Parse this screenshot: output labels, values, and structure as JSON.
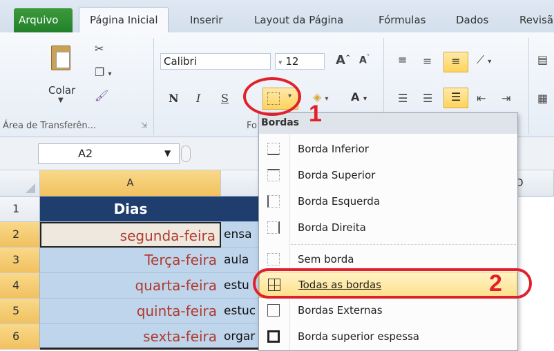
{
  "tabs": {
    "arquivo": "Arquivo",
    "inicio": "Página Inicial",
    "inserir": "Inserir",
    "layout": "Layout da Página",
    "formulas": "Fórmulas",
    "dados": "Dados",
    "revisao": "Revisã"
  },
  "ribbon": {
    "paste_label": "Colar",
    "clipboard_group": "Área de Transferên...",
    "font_group_partial": "Fo",
    "font_name": "Calibri",
    "font_size": "12",
    "bold": "N",
    "italic": "I",
    "underline": "S"
  },
  "name_box": "A2",
  "columns": [
    "A"
  ],
  "col_d_partial": "D",
  "rows": [
    {
      "num": "1",
      "a": "Dias",
      "b": ""
    },
    {
      "num": "2",
      "a": "segunda-feira",
      "b": "ensa"
    },
    {
      "num": "3",
      "a": "Terça-feira",
      "b": "aula"
    },
    {
      "num": "4",
      "a": "quarta-feira",
      "b": "estu"
    },
    {
      "num": "5",
      "a": "quinta-feira",
      "b": "estuc"
    },
    {
      "num": "6",
      "a": "sexta-feira",
      "b": "orgar"
    }
  ],
  "menu": {
    "title": "Bordas",
    "items": [
      {
        "label": "Borda Inferior",
        "icon": "border-bottom-icon"
      },
      {
        "label": "Borda Superior",
        "icon": "border-top-icon"
      },
      {
        "label": "Borda Esquerda",
        "icon": "border-left-icon"
      },
      {
        "label": "Borda Direita",
        "icon": "border-right-icon"
      },
      {
        "label": "Sem borda",
        "icon": "no-border-icon"
      },
      {
        "label": "Todas as bordas",
        "icon": "all-borders-icon"
      },
      {
        "label": "Bordas Externas",
        "icon": "outside-borders-icon"
      },
      {
        "label": "Borda superior espessa",
        "icon": "thick-box-border-icon"
      }
    ]
  },
  "annotations": {
    "step1": "1",
    "step2": "2"
  },
  "colors": {
    "header_blue": "#1f3e6e",
    "accent_red": "#e0202a",
    "cell_text_red": "#b03a2e"
  }
}
